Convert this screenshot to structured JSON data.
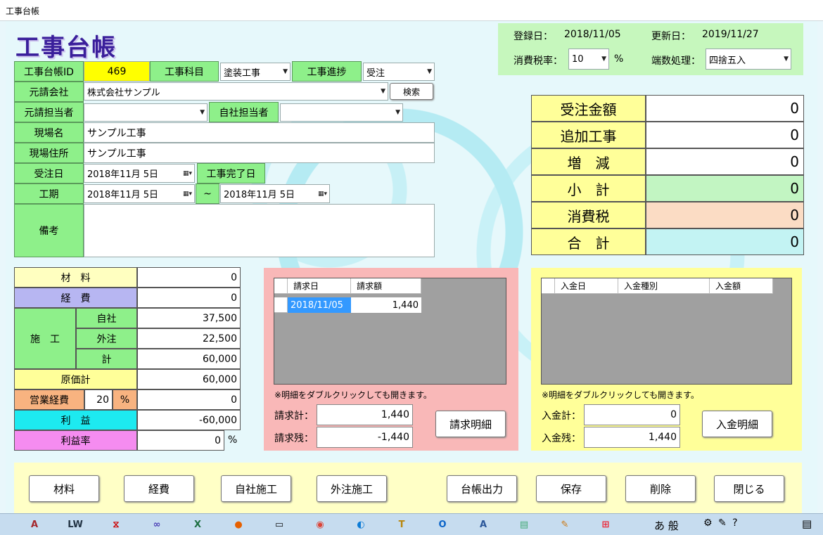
{
  "window": {
    "title": "工事台帳"
  },
  "heading": "工事台帳",
  "meta": {
    "registered_label": "登録日：",
    "registered_value": "2018/11/05",
    "updated_label": "更新日：",
    "updated_value": "2019/11/27",
    "tax_rate_label": "消費税率：",
    "tax_rate_value": "10",
    "tax_rate_unit": "%",
    "rounding_label": "端数処理：",
    "rounding_value": "四捨五入"
  },
  "form": {
    "id_label": "工事台帳ID",
    "id_value": "469",
    "subject_label": "工事科目",
    "subject_value": "塗装工事",
    "progress_label": "工事進捗",
    "progress_value": "受注",
    "contractor_label": "元請会社",
    "contractor_value": "株式会社サンプル",
    "search_label": "検索",
    "contractor_rep_label": "元請担当者",
    "contractor_rep_value": "",
    "own_rep_label": "自社担当者",
    "own_rep_value": "",
    "site_name_label": "現場名",
    "site_name_value": "サンプル工事",
    "site_address_label": "現場住所",
    "site_address_value": "サンプル工事",
    "order_date_label": "受注日",
    "order_date_value": "2018年11月  5日",
    "completion_label": "工事完了日",
    "period_label": "工期",
    "period_start": "2018年11月  5日",
    "period_sep": "~",
    "period_end": "2018年11月  5日",
    "notes_label": "備考",
    "notes_value": ""
  },
  "totals": [
    {
      "label": "受注金額",
      "value": "0",
      "color": "#ffffff"
    },
    {
      "label": "追加工事",
      "value": "0",
      "color": "#ffffff"
    },
    {
      "label": "増　減",
      "value": "0",
      "color": "#ffffff"
    },
    {
      "label": "小　計",
      "value": "0",
      "color": "#c2f5c2"
    },
    {
      "label": "消費税",
      "value": "0",
      "color": "#fbdcc4"
    },
    {
      "label": "合　計",
      "value": "0",
      "color": "#c3f3f3"
    }
  ],
  "costs": {
    "material_label": "材　料",
    "material_value": "0",
    "expense_label": "経　費",
    "expense_value": "0",
    "construction_label": "施　工",
    "own_label": "自社",
    "own_value": "37,500",
    "outsource_label": "外注",
    "outsource_value": "22,500",
    "subtotal_label": "計",
    "subtotal_value": "60,000",
    "cost_total_label": "原価計",
    "cost_total_value": "60,000",
    "sales_expense_label": "営業経費",
    "sales_expense_rate": "20",
    "sales_expense_unit": "%",
    "sales_expense_value": "0",
    "profit_label": "利　益",
    "profit_value": "-60,000",
    "profit_rate_label": "利益率",
    "profit_rate_value": "0",
    "profit_rate_unit": "%"
  },
  "billing": {
    "col_date": "請求日",
    "col_amount": "請求額",
    "rows": [
      {
        "date": "2018/11/05",
        "amount": "1,440"
      }
    ],
    "note": "※明細をダブルクリックしても開きます。",
    "total_label": "請求計：",
    "total_value": "1,440",
    "remain_label": "請求残：",
    "remain_value": "-1,440",
    "detail_button": "請求明細"
  },
  "payment": {
    "col_date": "入金日",
    "col_type": "入金種別",
    "col_amount": "入金額",
    "note": "※明細をダブルクリックしても開きます。",
    "total_label": "入金計：",
    "total_value": "0",
    "remain_label": "入金残：",
    "remain_value": "1,440",
    "detail_button": "入金明細"
  },
  "buttons": {
    "material": "材料",
    "expense": "経費",
    "own_work": "自社施工",
    "outsource_work": "外注施工",
    "print": "台帳出力",
    "save": "保存",
    "delete": "削除",
    "close": "閉じる"
  },
  "taskbar": {
    "ime_text": "あ 般",
    "icons": [
      "access-icon",
      "livewriter-icon",
      "pdf-icon",
      "infinity-icon",
      "excel-icon",
      "firefox-icon",
      "terminal-icon",
      "chrome-icon",
      "edge-icon",
      "text-editor-icon",
      "outlook-icon",
      "access-app-icon",
      "notepad-icon",
      "paint-icon",
      "windows-icon"
    ]
  }
}
